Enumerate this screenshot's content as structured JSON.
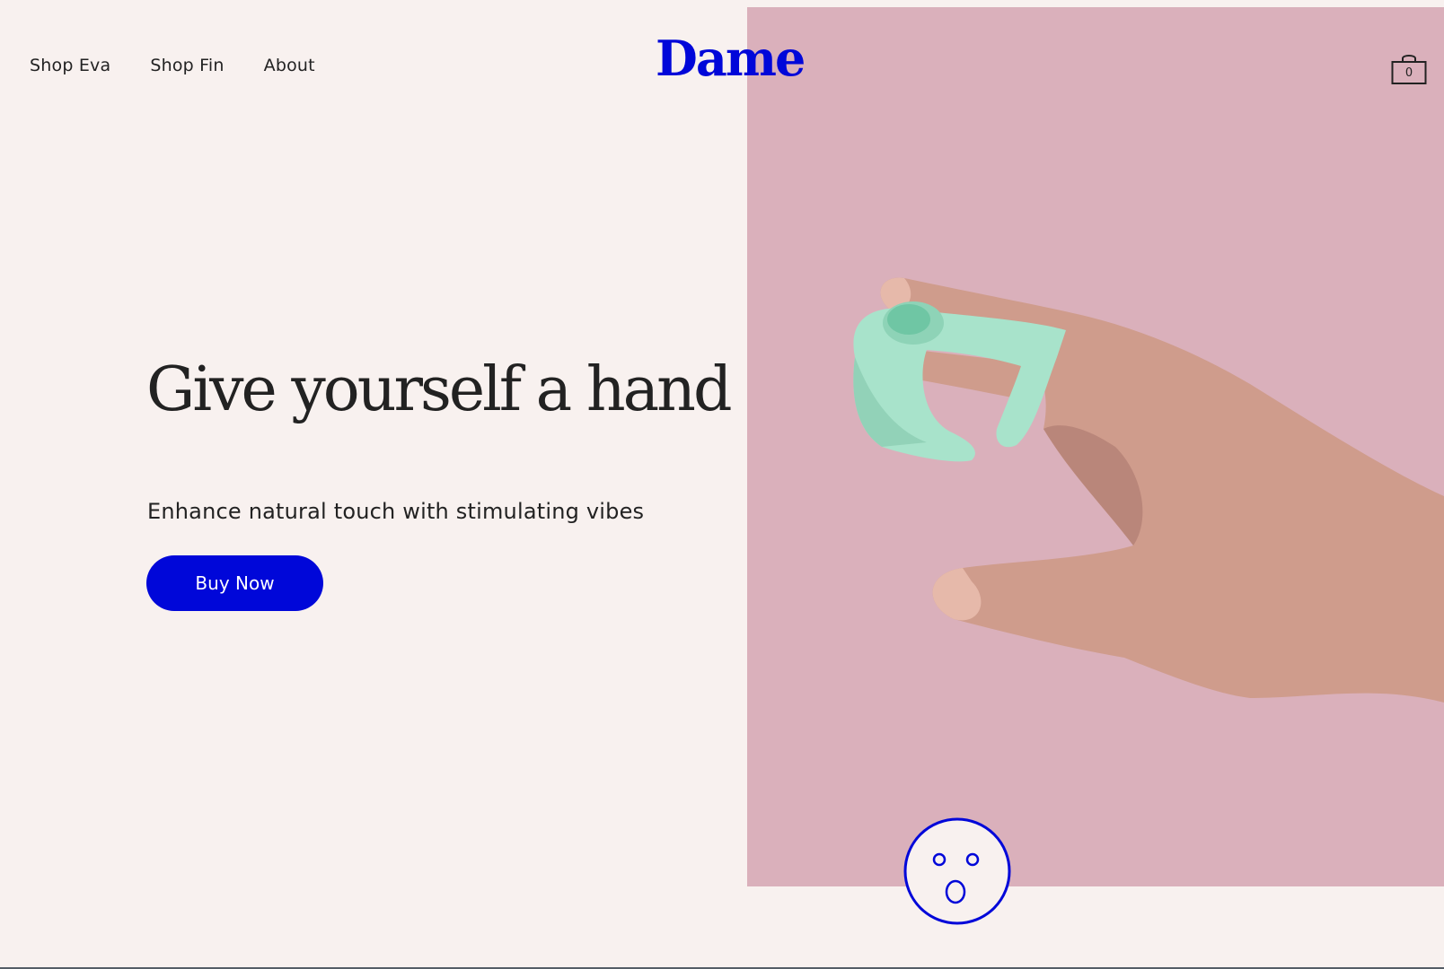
{
  "header": {
    "nav": [
      {
        "label": "Shop Eva"
      },
      {
        "label": "Shop Fin"
      },
      {
        "label": "About"
      }
    ],
    "logo": "Dame",
    "cart_count": "0"
  },
  "hero": {
    "headline": "Give yourself a hand",
    "subheadline": "Enhance natural touch with stimulating vibes",
    "cta_label": "Buy Now"
  },
  "theme": {
    "brand_blue": "#0007d9",
    "background": "#f8f1ef",
    "hero_pink": "#dab0bb",
    "product_mint": "#a8e3cb",
    "text": "#222222"
  },
  "icons": {
    "cart": "shopping-bag-icon",
    "face": "surprised-face-icon"
  }
}
